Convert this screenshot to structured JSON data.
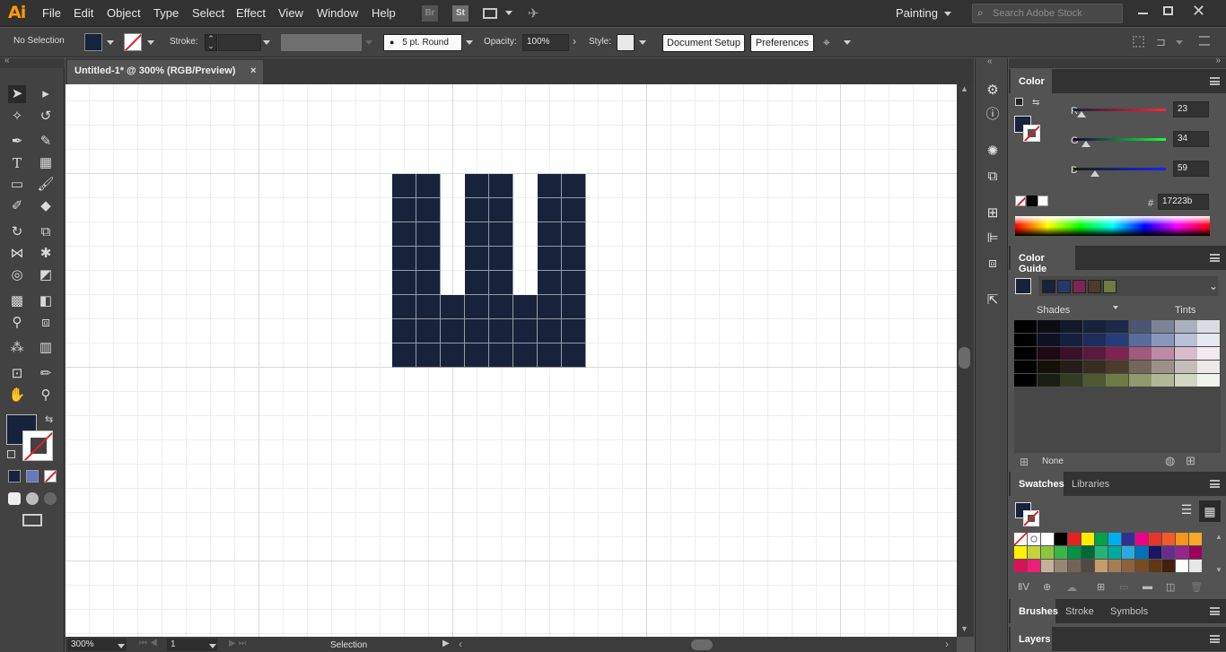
{
  "app": {
    "logo": "Ai",
    "workspace": "Painting",
    "search_placeholder": "Search Adobe Stock"
  },
  "menu": [
    "File",
    "Edit",
    "Object",
    "Type",
    "Select",
    "Effect",
    "View",
    "Window",
    "Help"
  ],
  "menu_icons": [
    "bridge-icon",
    "stock-icon",
    "arrange-documents-icon",
    "gpu-performance-icon"
  ],
  "menu_icon_labels": {
    "bridge": "Br",
    "stock": "St"
  },
  "control": {
    "selection": "No Selection",
    "stroke_label": "Stroke:",
    "brush": "5 pt. Round",
    "opacity_label": "Opacity:",
    "opacity": "100%",
    "style_label": "Style:",
    "document_setup": "Document Setup",
    "preferences": "Preferences"
  },
  "document": {
    "tab": "Untitled-1* @ 300% (RGB/Preview)",
    "close": "×"
  },
  "colors": {
    "fill": "#17223b",
    "stroke": "none",
    "canvas": "#ffffff",
    "ui_dark": "#323232",
    "ui_mid": "#535353",
    "accent_logo": "#ff9a00"
  },
  "status": {
    "zoom": "300%",
    "artboard": "1",
    "tool": "Selection"
  },
  "color_panel": {
    "title": "Color",
    "channels": [
      {
        "name": "R",
        "value": "23",
        "fraction": 0.09
      },
      {
        "name": "G",
        "value": "34",
        "fraction": 0.133
      },
      {
        "name": "B",
        "value": "59",
        "fraction": 0.231
      }
    ],
    "hex_label": "#",
    "hex": "17223b"
  },
  "color_guide": {
    "title": "Color Guide",
    "harmony": [
      "#17223b",
      "#253a6b",
      "#7c2551",
      "#4a3b2b",
      "#6e7b43"
    ],
    "shades_label": "Shades",
    "tints_label": "Tints",
    "grid": [
      [
        "#000000",
        "#0b0e14",
        "#121a2c",
        "#17223b",
        "#1c2a48",
        "#4b5670",
        "#7b8496",
        "#aab0bd",
        "#d9dce2"
      ],
      [
        "#000000",
        "#0c1224",
        "#142040",
        "#1d2d5b",
        "#273d7a",
        "#5a6c9e",
        "#8898bb",
        "#b7c1d7",
        "#e5e9f1"
      ],
      [
        "#000000",
        "#1e0914",
        "#3b1029",
        "#5a1a3d",
        "#7c2551",
        "#a05a7e",
        "#bd8ba5",
        "#d8bccb",
        "#f2eaee"
      ],
      [
        "#000000",
        "#141008",
        "#251e16",
        "#372d21",
        "#4a3b2b",
        "#73665a",
        "#9b9188",
        "#c4beb8",
        "#ece9e6"
      ],
      [
        "#000000",
        "#1b1f12",
        "#343b23",
        "#4e5933",
        "#6e7b43",
        "#8f9a6d",
        "#b0b898",
        "#d1d6c3",
        "#f1f3ed"
      ]
    ],
    "footer": "None"
  },
  "swatches_panel": {
    "tabs": [
      "Swatches",
      "Libraries"
    ],
    "rows": [
      [
        "none",
        "register",
        "#ffffff",
        "#000000",
        "#e62121",
        "#ffed00",
        "#00a14b",
        "#00aeef",
        "#2e3192",
        "#ec008c",
        "#e7332a",
        "#f15a29",
        "#f7941d",
        "#f9a825"
      ],
      [
        "#fff200",
        "#c2d33c",
        "#8cc63f",
        "#39b54a",
        "#009245",
        "#006837",
        "#22b573",
        "#00a99d",
        "#29abe2",
        "#0071bc",
        "#1b1464",
        "#662d91",
        "#93278f",
        "#9e005d"
      ],
      [
        "#d4145a",
        "#ed1e79",
        "#c7b299",
        "#998675",
        "#736357",
        "#534741",
        "#c69c6d",
        "#a67c52",
        "#8c6239",
        "#754c24",
        "#603813",
        "#42210b",
        "#fefefe",
        "#e8e8e8"
      ]
    ]
  },
  "bottom_tabs": [
    "Brushes",
    "Stroke",
    "Symbols"
  ],
  "layers_tab": "Layers",
  "artwork": {
    "grid_columns": 8,
    "grid_rows": 8,
    "cells": [
      [
        1,
        1,
        0,
        1,
        1,
        0,
        1,
        1
      ],
      [
        1,
        1,
        0,
        1,
        1,
        0,
        1,
        1
      ],
      [
        1,
        1,
        0,
        1,
        1,
        0,
        1,
        1
      ],
      [
        1,
        1,
        0,
        1,
        1,
        0,
        1,
        1
      ],
      [
        1,
        1,
        0,
        1,
        1,
        0,
        1,
        1
      ],
      [
        1,
        1,
        1,
        1,
        1,
        1,
        1,
        1
      ],
      [
        1,
        1,
        1,
        1,
        1,
        1,
        1,
        1
      ],
      [
        1,
        1,
        1,
        1,
        1,
        1,
        1,
        1
      ]
    ]
  }
}
